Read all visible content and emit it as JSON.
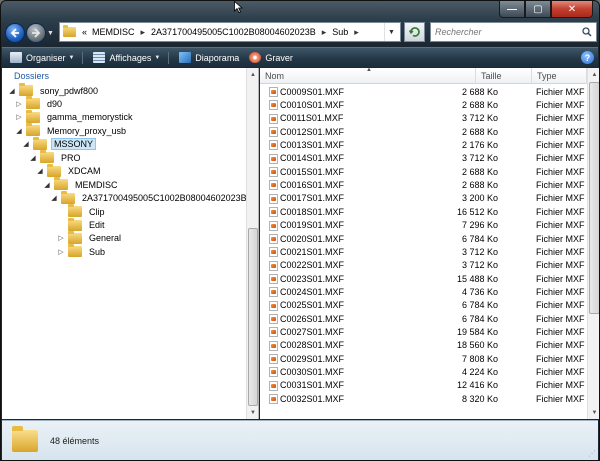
{
  "window": {
    "controls": {
      "minimize": "—",
      "maximize": "▢",
      "close": "✕"
    }
  },
  "nav": {
    "back_icon": "back-arrow-icon",
    "forward_icon": "forward-arrow-icon",
    "breadcrumb_overflow": "«",
    "breadcrumb": [
      "MEMDISC",
      "2A371700495005C1002B08004602023B",
      "Sub"
    ],
    "search_placeholder": "Rechercher"
  },
  "toolbar": {
    "organize": "Organiser",
    "views": "Affichages",
    "slideshow": "Diaporama",
    "burn": "Graver",
    "help": "?"
  },
  "tree": {
    "header": "Dossiers",
    "items": [
      {
        "label": "sony_pdwf800",
        "level": 0,
        "state": "open"
      },
      {
        "label": "d90",
        "level": 1,
        "state": "closed"
      },
      {
        "label": "gamma_memorystick",
        "level": 1,
        "state": "closed"
      },
      {
        "label": "Memory_proxy_usb",
        "level": 1,
        "state": "open"
      },
      {
        "label": "MSSONY",
        "level": 2,
        "state": "open",
        "selected": true
      },
      {
        "label": "PRO",
        "level": 3,
        "state": "open"
      },
      {
        "label": "XDCAM",
        "level": 4,
        "state": "open"
      },
      {
        "label": "MEMDISC",
        "level": 5,
        "state": "open"
      },
      {
        "label": "2A371700495005C1002B08004602023B",
        "level": 6,
        "state": "open"
      },
      {
        "label": "Clip",
        "level": 7,
        "state": "none"
      },
      {
        "label": "Edit",
        "level": 7,
        "state": "none"
      },
      {
        "label": "General",
        "level": 7,
        "state": "closed"
      },
      {
        "label": "Sub",
        "level": 7,
        "state": "closed"
      }
    ]
  },
  "columns": {
    "name": "Nom",
    "size": "Taille",
    "type": "Type"
  },
  "files": [
    {
      "name": "C0009S01.MXF",
      "size": "2 688 Ko",
      "type": "Fichier MXF"
    },
    {
      "name": "C0010S01.MXF",
      "size": "2 688 Ko",
      "type": "Fichier MXF"
    },
    {
      "name": "C0011S01.MXF",
      "size": "3 712 Ko",
      "type": "Fichier MXF"
    },
    {
      "name": "C0012S01.MXF",
      "size": "2 688 Ko",
      "type": "Fichier MXF"
    },
    {
      "name": "C0013S01.MXF",
      "size": "2 176 Ko",
      "type": "Fichier MXF"
    },
    {
      "name": "C0014S01.MXF",
      "size": "3 712 Ko",
      "type": "Fichier MXF"
    },
    {
      "name": "C0015S01.MXF",
      "size": "2 688 Ko",
      "type": "Fichier MXF"
    },
    {
      "name": "C0016S01.MXF",
      "size": "2 688 Ko",
      "type": "Fichier MXF"
    },
    {
      "name": "C0017S01.MXF",
      "size": "3 200 Ko",
      "type": "Fichier MXF"
    },
    {
      "name": "C0018S01.MXF",
      "size": "16 512 Ko",
      "type": "Fichier MXF"
    },
    {
      "name": "C0019S01.MXF",
      "size": "7 296 Ko",
      "type": "Fichier MXF"
    },
    {
      "name": "C0020S01.MXF",
      "size": "6 784 Ko",
      "type": "Fichier MXF"
    },
    {
      "name": "C0021S01.MXF",
      "size": "3 712 Ko",
      "type": "Fichier MXF"
    },
    {
      "name": "C0022S01.MXF",
      "size": "3 712 Ko",
      "type": "Fichier MXF"
    },
    {
      "name": "C0023S01.MXF",
      "size": "15 488 Ko",
      "type": "Fichier MXF"
    },
    {
      "name": "C0024S01.MXF",
      "size": "4 736 Ko",
      "type": "Fichier MXF"
    },
    {
      "name": "C0025S01.MXF",
      "size": "6 784 Ko",
      "type": "Fichier MXF"
    },
    {
      "name": "C0026S01.MXF",
      "size": "6 784 Ko",
      "type": "Fichier MXF"
    },
    {
      "name": "C0027S01.MXF",
      "size": "19 584 Ko",
      "type": "Fichier MXF"
    },
    {
      "name": "C0028S01.MXF",
      "size": "18 560 Ko",
      "type": "Fichier MXF"
    },
    {
      "name": "C0029S01.MXF",
      "size": "7 808 Ko",
      "type": "Fichier MXF"
    },
    {
      "name": "C0030S01.MXF",
      "size": "4 224 Ko",
      "type": "Fichier MXF"
    },
    {
      "name": "C0031S01.MXF",
      "size": "12 416 Ko",
      "type": "Fichier MXF"
    },
    {
      "name": "C0032S01.MXF",
      "size": "8 320 Ko",
      "type": "Fichier MXF"
    }
  ],
  "status": {
    "count": "48 éléments"
  }
}
